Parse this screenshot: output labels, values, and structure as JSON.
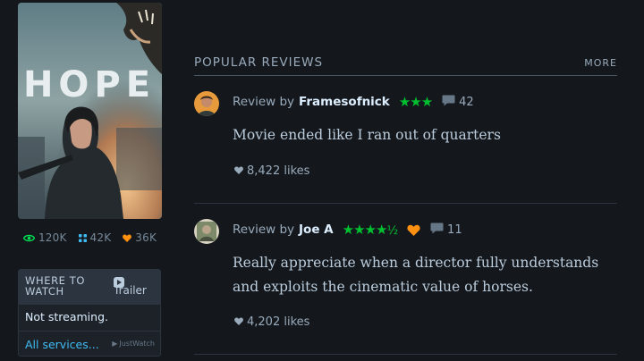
{
  "film": {
    "poster_title": "HOPE",
    "stats": {
      "watched": "120K",
      "lists": "42K",
      "likes": "36K"
    }
  },
  "where_to_watch": {
    "title": "WHERE TO WATCH",
    "trailer_label": "Trailer",
    "status": "Not streaming.",
    "all_services": "All services...",
    "provider_credit": "JustWatch"
  },
  "popular_reviews": {
    "title": "POPULAR REVIEWS",
    "more_label": "MORE",
    "reviews": [
      {
        "prefix": "Review by",
        "author": "Framesofnick",
        "rating": "★★★",
        "rating_half": "",
        "comments": "42",
        "text": "Movie ended like I ran out of quarters",
        "likes": "8,422 likes"
      },
      {
        "prefix": "Review by",
        "author": "Joe A",
        "rating": "★★★★",
        "rating_half": "½",
        "comments": "11",
        "text": "Really appreciate when a director fully understands and exploits the cinematic value of horses.",
        "likes": "4,202 likes"
      }
    ]
  },
  "colors": {
    "background": "#14181c",
    "rating_green": "#00c030",
    "liked_orange": "#ff9010",
    "link_blue": "#40bcf4",
    "watched_green": "#00e054",
    "lists_blue": "#40bcf4"
  },
  "icons": {
    "watched": "eye-icon",
    "lists": "grid-icon",
    "likes": "heart-icon",
    "trailer": "play-icon",
    "comments": "speech-bubble-icon",
    "review_likes": "heart-icon"
  }
}
